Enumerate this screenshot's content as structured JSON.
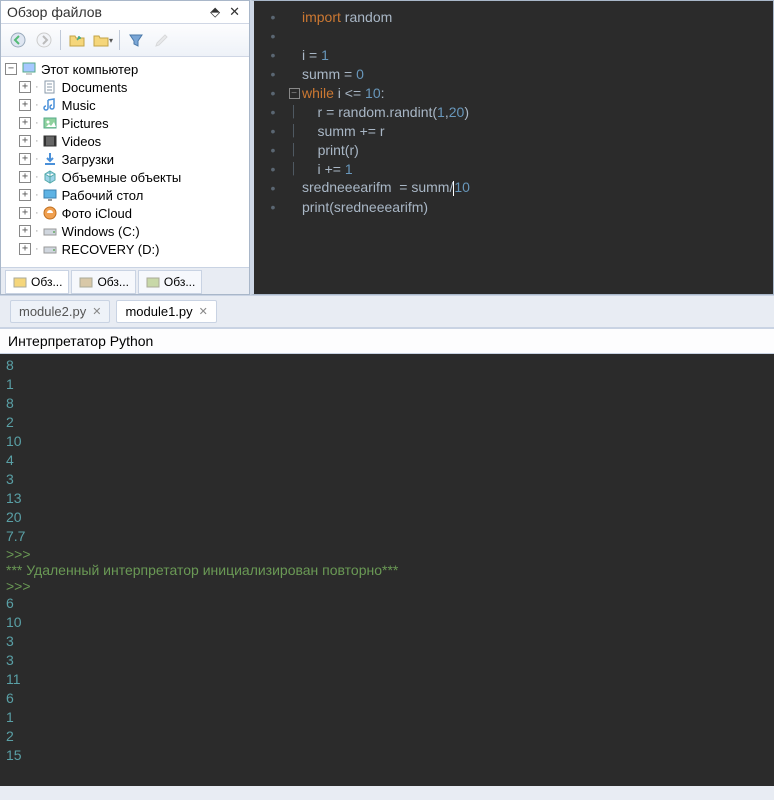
{
  "panel": {
    "title": "Обзор файлов"
  },
  "tree": {
    "root": "Этот компьютер",
    "items": [
      {
        "label": "Documents",
        "icon": "doc"
      },
      {
        "label": "Music",
        "icon": "music"
      },
      {
        "label": "Pictures",
        "icon": "pic"
      },
      {
        "label": "Videos",
        "icon": "video"
      },
      {
        "label": "Загрузки",
        "icon": "download"
      },
      {
        "label": "Объемные объекты",
        "icon": "cube"
      },
      {
        "label": "Рабочий стол",
        "icon": "desktop"
      },
      {
        "label": "Фото iCloud",
        "icon": "photo"
      },
      {
        "label": "Windows (C:)",
        "icon": "drive"
      },
      {
        "label": "RECOVERY (D:)",
        "icon": "drive"
      }
    ]
  },
  "mini_tabs": [
    {
      "label": "Обз...",
      "active": true
    },
    {
      "label": "Обз...",
      "active": false
    },
    {
      "label": "Обз...",
      "active": false
    }
  ],
  "code": {
    "lines": [
      [
        {
          "t": "import ",
          "c": "kw"
        },
        {
          "t": "random",
          "c": "id"
        }
      ],
      [],
      [
        {
          "t": "i ",
          "c": "id"
        },
        {
          "t": "= ",
          "c": "op"
        },
        {
          "t": "1",
          "c": "num"
        }
      ],
      [
        {
          "t": "summ ",
          "c": "id"
        },
        {
          "t": "= ",
          "c": "op"
        },
        {
          "t": "0",
          "c": "num"
        }
      ],
      [
        {
          "t": "while ",
          "c": "kw"
        },
        {
          "t": "i ",
          "c": "id"
        },
        {
          "t": "<= ",
          "c": "op"
        },
        {
          "t": "10",
          "c": "num"
        },
        {
          "t": ":",
          "c": "op"
        }
      ],
      [
        {
          "t": "    r ",
          "c": "id"
        },
        {
          "t": "= ",
          "c": "op"
        },
        {
          "t": "random.randint",
          "c": "fn"
        },
        {
          "t": "(",
          "c": "op"
        },
        {
          "t": "1",
          "c": "num"
        },
        {
          "t": ",",
          "c": "op"
        },
        {
          "t": "20",
          "c": "num"
        },
        {
          "t": ")",
          "c": "op"
        }
      ],
      [
        {
          "t": "    summ ",
          "c": "id"
        },
        {
          "t": "+= ",
          "c": "op"
        },
        {
          "t": "r",
          "c": "id"
        }
      ],
      [
        {
          "t": "    ",
          "c": "id"
        },
        {
          "t": "print",
          "c": "fn"
        },
        {
          "t": "(",
          "c": "op"
        },
        {
          "t": "r",
          "c": "id"
        },
        {
          "t": ")",
          "c": "op"
        }
      ],
      [
        {
          "t": "    i ",
          "c": "id"
        },
        {
          "t": "+= ",
          "c": "op"
        },
        {
          "t": "1",
          "c": "num"
        }
      ],
      [
        {
          "t": "sredneeearifm  ",
          "c": "id"
        },
        {
          "t": "= ",
          "c": "op"
        },
        {
          "t": "summ",
          "c": "id"
        },
        {
          "t": "/",
          "c": "op"
        },
        {
          "t": "10",
          "c": "num"
        }
      ],
      [
        {
          "t": "print",
          "c": "fn"
        },
        {
          "t": "(",
          "c": "op"
        },
        {
          "t": "sredneeearifm",
          "c": "id"
        },
        {
          "t": ")",
          "c": "op"
        }
      ]
    ],
    "fold_at": 4,
    "cursor_line": 9,
    "cursor_after_token": 4
  },
  "editor_tabs": [
    {
      "label": "module2.py",
      "active": false
    },
    {
      "label": "module1.py",
      "active": true
    }
  ],
  "interpreter": {
    "title": "Интерпретатор Python",
    "lines": [
      {
        "t": "8",
        "c": "out"
      },
      {
        "t": "1",
        "c": "out"
      },
      {
        "t": "8",
        "c": "out"
      },
      {
        "t": "2",
        "c": "out"
      },
      {
        "t": "10",
        "c": "out"
      },
      {
        "t": "4",
        "c": "out"
      },
      {
        "t": "3",
        "c": "out"
      },
      {
        "t": "13",
        "c": "out"
      },
      {
        "t": "20",
        "c": "out"
      },
      {
        "t": "7.7",
        "c": "out"
      },
      {
        "t": ">>>",
        "c": "prompt"
      },
      {
        "t": "*** Удаленный интерпретатор инициализирован повторно***",
        "c": "msg"
      },
      {
        "t": ">>>",
        "c": "prompt"
      },
      {
        "t": "6",
        "c": "out"
      },
      {
        "t": "10",
        "c": "out"
      },
      {
        "t": "3",
        "c": "out"
      },
      {
        "t": "3",
        "c": "out"
      },
      {
        "t": "11",
        "c": "out"
      },
      {
        "t": "6",
        "c": "out"
      },
      {
        "t": "1",
        "c": "out"
      },
      {
        "t": "2",
        "c": "out"
      },
      {
        "t": "15",
        "c": "out"
      }
    ]
  }
}
